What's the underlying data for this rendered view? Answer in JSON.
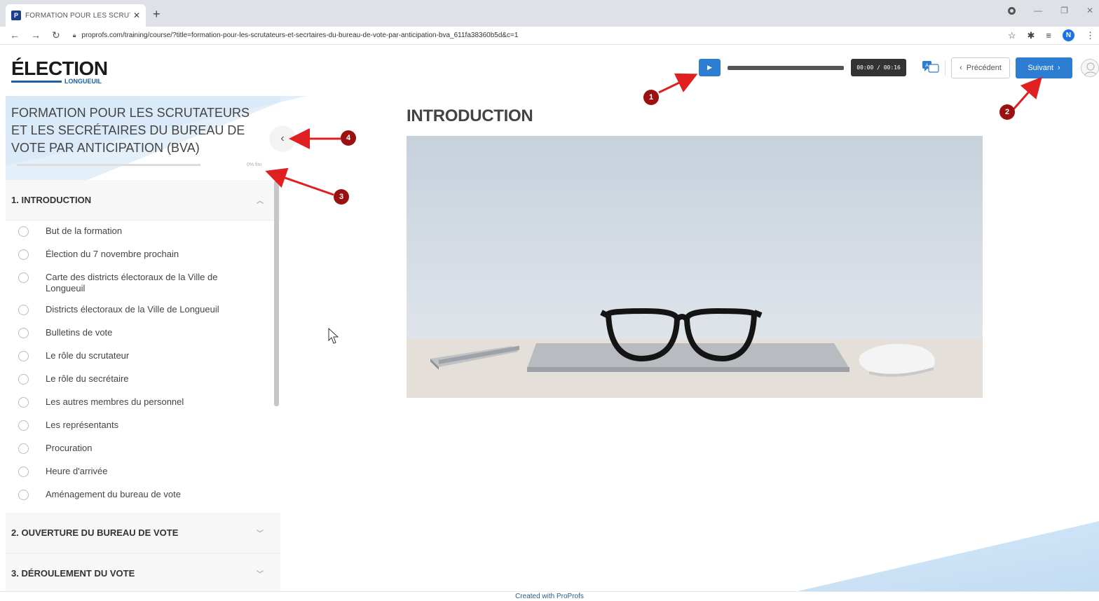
{
  "browser": {
    "tab_title": "FORMATION POUR LES SCRUTA",
    "tab_favicon": "P",
    "url": "proprofs.com/training/course/?title=formation-pour-les-scrutateurs-et-secrtaires-du-bureau-de-vote-par-anticipation-bva_611fa38360b5d&c=1",
    "profile_initial": "N"
  },
  "header": {
    "logo_word": "ÉLECTION",
    "logo_sub": "LONGUEUIL",
    "timer": "00:00 / 00:16",
    "audio_progress": 0.0,
    "prev_label": "Précédent",
    "next_label": "Suivant"
  },
  "sidebar": {
    "course_title": "FORMATION POUR LES SCRUTATEURS ET LES SECRÉTAIRES DU BUREAU DE VOTE PAR ANTICIPATION (BVA)",
    "progress_pct_label": "0% fini",
    "sections": [
      {
        "title": "1.  INTRODUCTION",
        "expanded": true,
        "lessons": [
          "But de la formation",
          "Élection du 7 novembre prochain",
          "Carte des districts électoraux de la Ville de Longueuil",
          "Districts électoraux de la Ville de Longueuil",
          "Bulletins de vote",
          "Le rôle du scrutateur",
          "Le rôle du secrétaire",
          "Les autres membres du personnel",
          "Les représentants",
          "Procuration",
          "Heure d'arrivée",
          "Aménagement du bureau de vote"
        ]
      },
      {
        "title": "2.  OUVERTURE DU BUREAU DE VOTE",
        "expanded": false,
        "lessons": []
      },
      {
        "title": "3.  DÉROULEMENT DU VOTE",
        "expanded": false,
        "lessons": []
      }
    ]
  },
  "main": {
    "title": "INTRODUCTION"
  },
  "footer": {
    "credit": "Created with ProProfs"
  },
  "annotations": [
    "1",
    "2",
    "3",
    "4"
  ],
  "colors": {
    "accent": "#2d7dd2",
    "marker": "#9b1111",
    "arrow": "#e02020"
  }
}
